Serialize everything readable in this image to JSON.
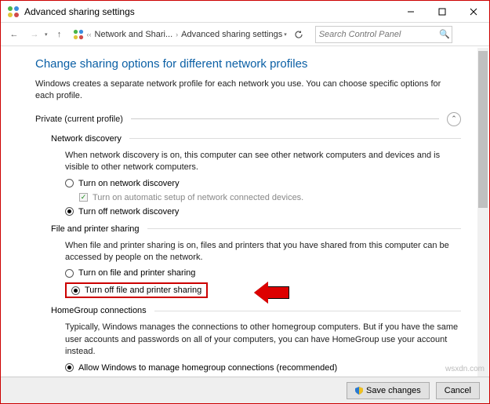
{
  "window": {
    "title": "Advanced sharing settings"
  },
  "breadcrumb": {
    "item1": "Network and Shari...",
    "item2": "Advanced sharing settings"
  },
  "search": {
    "placeholder": "Search Control Panel"
  },
  "page": {
    "heading": "Change sharing options for different network profiles",
    "intro": "Windows creates a separate network profile for each network you use. You can choose specific options for each profile."
  },
  "profile": {
    "label": "Private (current profile)"
  },
  "network_discovery": {
    "title": "Network discovery",
    "desc": "When network discovery is on, this computer can see other network computers and devices and is visible to other network computers.",
    "opt_on": "Turn on network discovery",
    "opt_auto": "Turn on automatic setup of network connected devices.",
    "opt_off": "Turn off network discovery"
  },
  "file_sharing": {
    "title": "File and printer sharing",
    "desc": "When file and printer sharing is on, files and printers that you have shared from this computer can be accessed by people on the network.",
    "opt_on": "Turn on file and printer sharing",
    "opt_off": "Turn off file and printer sharing"
  },
  "homegroup": {
    "title": "HomeGroup connections",
    "desc": "Typically, Windows manages the connections to other homegroup computers. But if you have the same user accounts and passwords on all of your computers, you can have HomeGroup use your account instead.",
    "opt_allow": "Allow Windows to manage homegroup connections (recommended)"
  },
  "footer": {
    "save": "Save changes",
    "cancel": "Cancel"
  },
  "watermark": "wsxdn.com"
}
